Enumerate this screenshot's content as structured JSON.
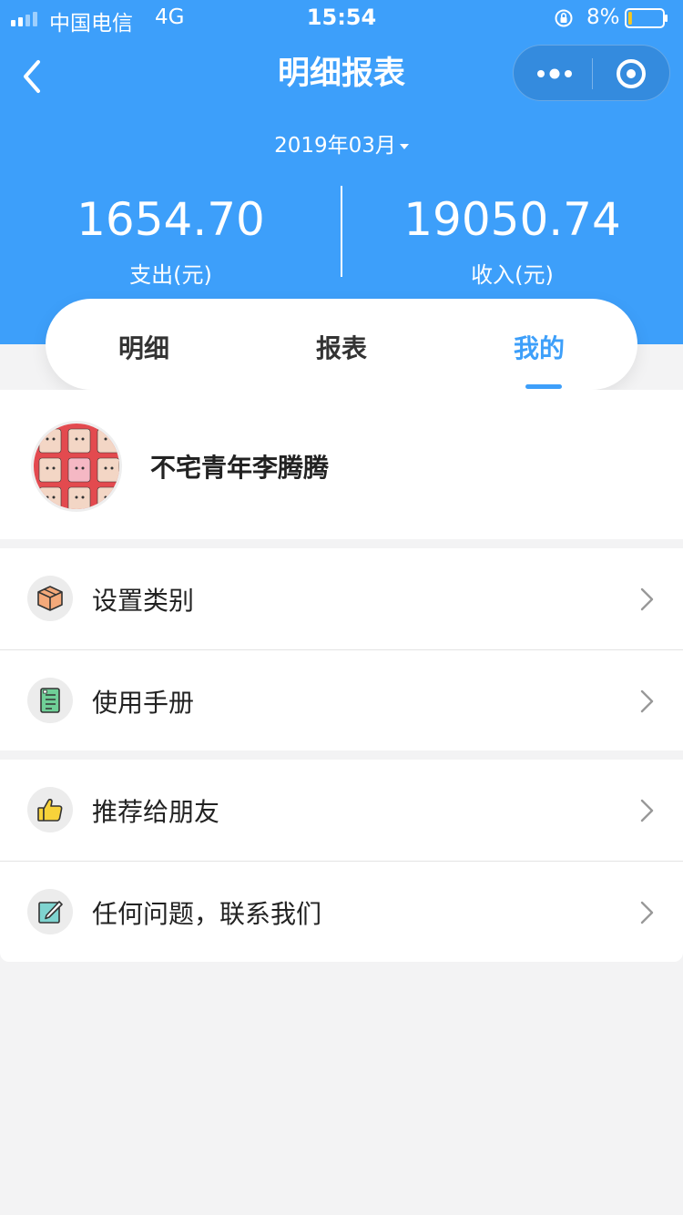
{
  "status_bar": {
    "carrier": "中国电信",
    "network": "4G",
    "time": "15:54",
    "battery_percent": "8%",
    "battery_level": 0.08
  },
  "nav": {
    "title": "明细报表",
    "icons": [
      "back-icon",
      "more-icon",
      "close-circle-icon"
    ]
  },
  "month": "2019年03月",
  "stats": {
    "expense_amount": "1654.70",
    "expense_label": "支出(元)",
    "income_amount": "19050.74",
    "income_label": "收入(元)"
  },
  "tabs": [
    {
      "label": "明细",
      "active": false
    },
    {
      "label": "报表",
      "active": false
    },
    {
      "label": "我的",
      "active": true
    }
  ],
  "profile": {
    "name": "不宅青年李腾腾"
  },
  "menu": [
    {
      "label": "设置类别",
      "icon": "box-icon"
    },
    {
      "label": "使用手册",
      "icon": "manual-icon"
    },
    {
      "label": "推荐给朋友",
      "icon": "thumbs-up-icon"
    },
    {
      "label": "任何问题，联系我们",
      "icon": "edit-icon"
    }
  ],
  "colors": {
    "accent": "#3d9ffa",
    "background": "#f3f3f4"
  }
}
